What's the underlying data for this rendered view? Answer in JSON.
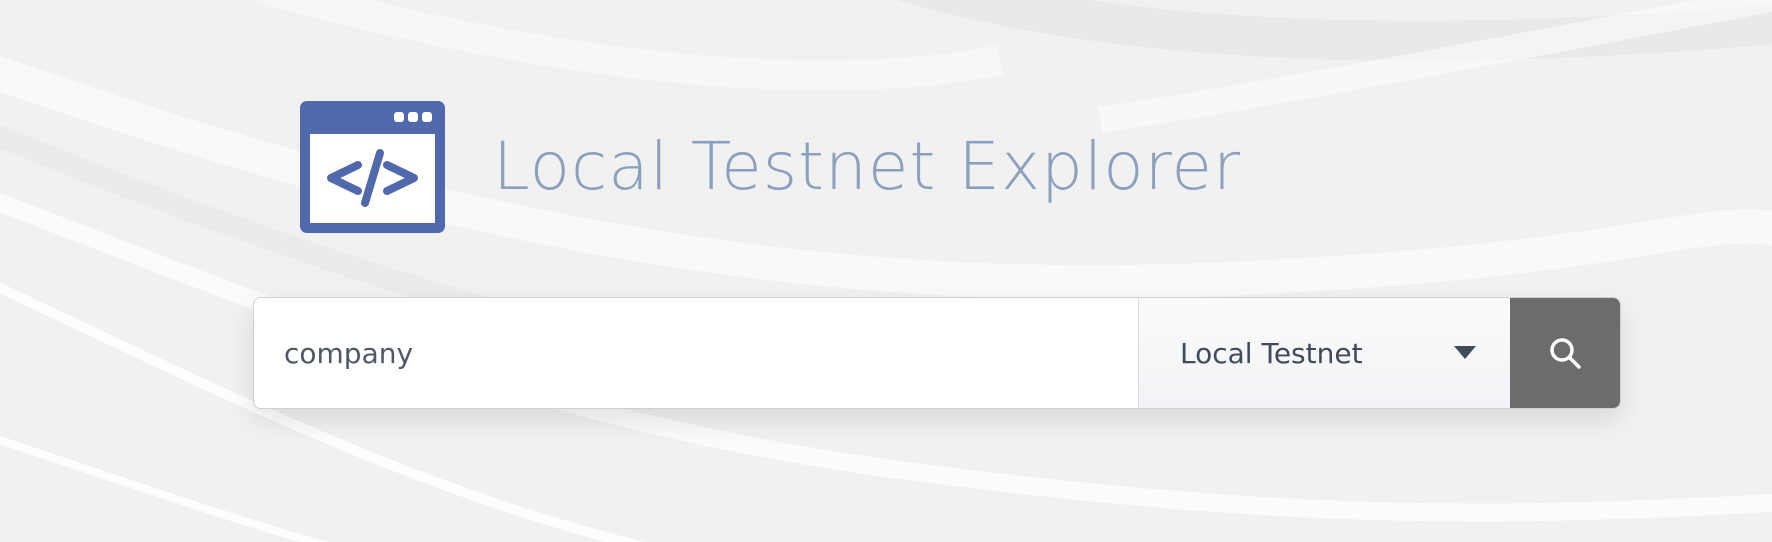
{
  "header": {
    "logo_icon": "browser-code-icon",
    "title": "Local Testnet Explorer",
    "brand_color": "#5068ac",
    "title_color": "#8aa0bd"
  },
  "search": {
    "value": "company",
    "network_selected": "Local Testnet",
    "dropdown_icon": "caret-down-icon",
    "button_icon": "search-icon",
    "button_color": "#6c6c6c"
  }
}
